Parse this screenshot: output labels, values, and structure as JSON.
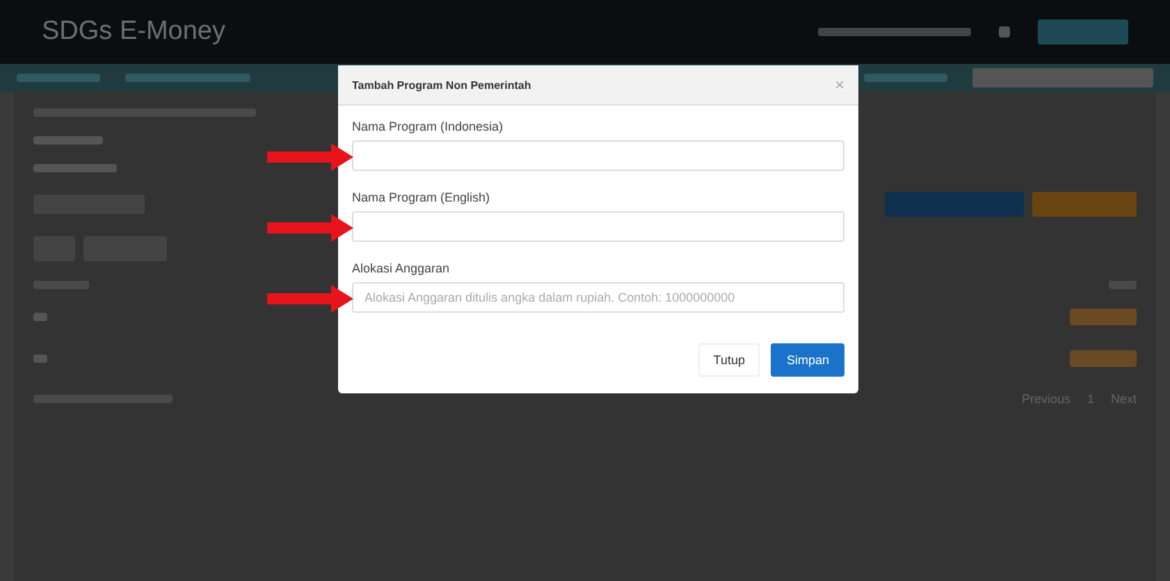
{
  "app": {
    "brand": "SDGs E-Money"
  },
  "pagination": {
    "previous": "Previous",
    "page": "1",
    "next": "Next"
  },
  "modal": {
    "title": "Tambah Program Non Pemerintah",
    "close": "×",
    "fields": [
      {
        "label": "Nama Program (Indonesia)",
        "arrow": true
      },
      {
        "label": "Nama Program (English)",
        "arrow": true
      },
      {
        "label": "Alokasi Anggaran",
        "placeholder": "Alokasi Anggaran ditulis angka dalam rupiah. Contoh: 1000000000",
        "arrow": true
      }
    ],
    "buttons": [
      {
        "label": "Tutup",
        "kind": "secondary"
      },
      {
        "label": "Simpan",
        "kind": "primary"
      }
    ]
  }
}
